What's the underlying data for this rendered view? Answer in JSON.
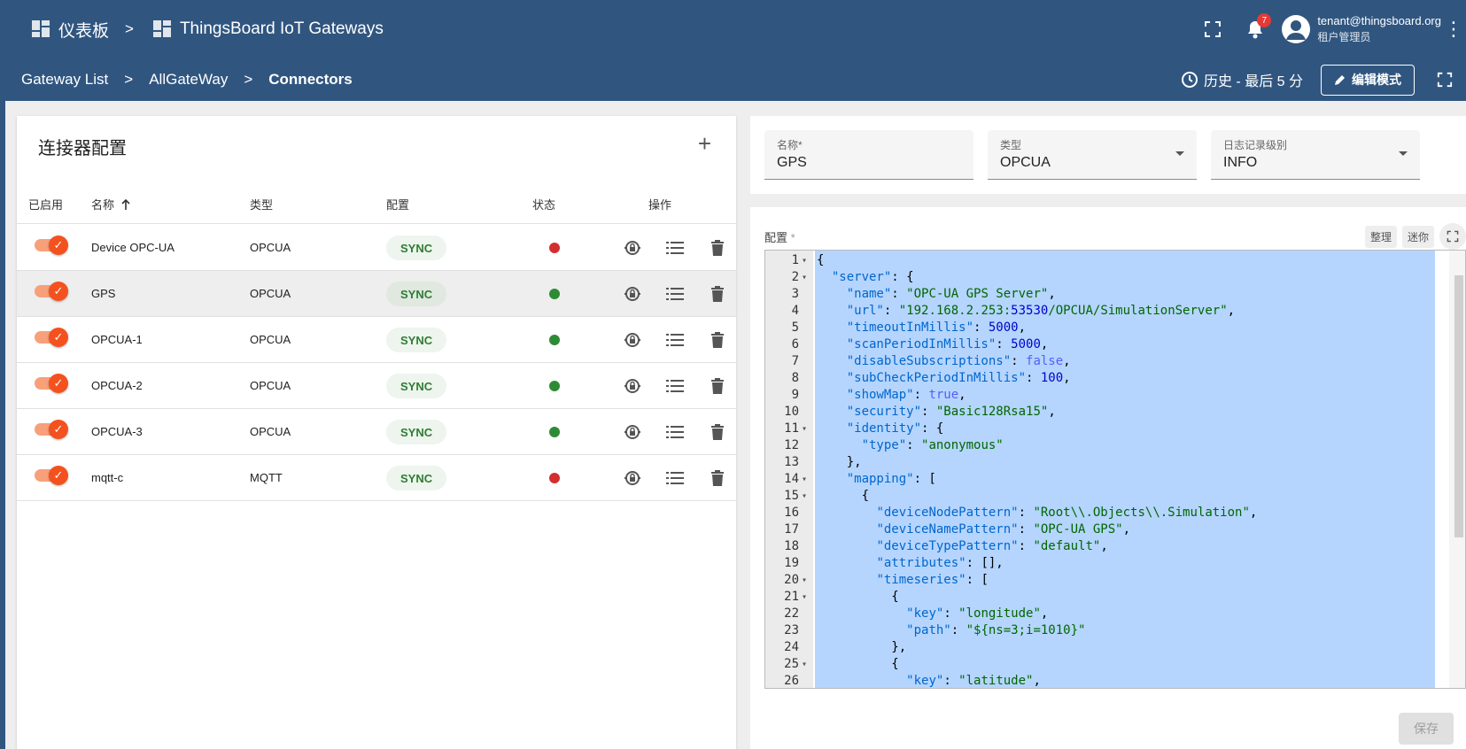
{
  "topbar": {
    "dashboards": "仪表板",
    "separator": ">",
    "dashboard_title": "ThingsBoard IoT Gateways",
    "notifications_count": "7",
    "user_email": "tenant@thingsboard.org",
    "user_role": "租户管理员"
  },
  "subbar": {
    "crumbs": [
      "Gateway List",
      "AllGateWay",
      "Connectors"
    ],
    "separator": ">",
    "history": "历史 - 最后 5 分",
    "edit_mode": "编辑模式"
  },
  "left_card": {
    "title": "连接器配置",
    "add": "+",
    "columns": {
      "enabled": "已启用",
      "name": "名称",
      "type": "类型",
      "config": "配置",
      "status": "状态",
      "actions": "操作"
    },
    "rows": [
      {
        "name": "Device OPC-UA",
        "type": "OPCUA",
        "config": "SYNC",
        "status_color": "#d32f2f",
        "enabled": true
      },
      {
        "name": "GPS",
        "type": "OPCUA",
        "config": "SYNC",
        "status_color": "#2e8b35",
        "enabled": true
      },
      {
        "name": "OPCUA-1",
        "type": "OPCUA",
        "config": "SYNC",
        "status_color": "#2e8b35",
        "enabled": true
      },
      {
        "name": "OPCUA-2",
        "type": "OPCUA",
        "config": "SYNC",
        "status_color": "#2e8b35",
        "enabled": true
      },
      {
        "name": "OPCUA-3",
        "type": "OPCUA",
        "config": "SYNC",
        "status_color": "#2e8b35",
        "enabled": true
      },
      {
        "name": "mqtt-c",
        "type": "MQTT",
        "config": "SYNC",
        "status_color": "#d32f2f",
        "enabled": true
      }
    ]
  },
  "right_top": {
    "name_label": "名称*",
    "name_value": "GPS",
    "type_label": "类型",
    "type_value": "OPCUA",
    "log_label": "日志记录级别",
    "log_value": "INFO"
  },
  "right_bottom": {
    "config_label": "配置",
    "required_mark": "*",
    "format": "整理",
    "minify": "迷你",
    "save": "保存"
  },
  "code_lines": [
    {
      "n": "1",
      "f": "▾",
      "t": "{"
    },
    {
      "n": "2",
      "f": "▾",
      "t": "  \"server\": {"
    },
    {
      "n": "3",
      "f": "",
      "t": "    \"name\": \"OPC-UA GPS Server\","
    },
    {
      "n": "4",
      "f": "",
      "t": "    \"url\": \"192.168.2.253:53530/OPCUA/SimulationServer\","
    },
    {
      "n": "5",
      "f": "",
      "t": "    \"timeoutInMillis\": 5000,"
    },
    {
      "n": "6",
      "f": "",
      "t": "    \"scanPeriodInMillis\": 5000,"
    },
    {
      "n": "7",
      "f": "",
      "t": "    \"disableSubscriptions\": false,"
    },
    {
      "n": "8",
      "f": "",
      "t": "    \"subCheckPeriodInMillis\": 100,"
    },
    {
      "n": "9",
      "f": "",
      "t": "    \"showMap\": true,"
    },
    {
      "n": "10",
      "f": "",
      "t": "    \"security\": \"Basic128Rsa15\","
    },
    {
      "n": "11",
      "f": "▾",
      "t": "    \"identity\": {"
    },
    {
      "n": "12",
      "f": "",
      "t": "      \"type\": \"anonymous\""
    },
    {
      "n": "13",
      "f": "",
      "t": "    },"
    },
    {
      "n": "14",
      "f": "▾",
      "t": "    \"mapping\": ["
    },
    {
      "n": "15",
      "f": "▾",
      "t": "      {"
    },
    {
      "n": "16",
      "f": "",
      "t": "        \"deviceNodePattern\": \"Root\\\\.Objects\\\\.Simulation\","
    },
    {
      "n": "17",
      "f": "",
      "t": "        \"deviceNamePattern\": \"OPC-UA GPS\","
    },
    {
      "n": "18",
      "f": "",
      "t": "        \"deviceTypePattern\": \"default\","
    },
    {
      "n": "19",
      "f": "",
      "t": "        \"attributes\": [],"
    },
    {
      "n": "20",
      "f": "▾",
      "t": "        \"timeseries\": ["
    },
    {
      "n": "21",
      "f": "▾",
      "t": "          {"
    },
    {
      "n": "22",
      "f": "",
      "t": "            \"key\": \"longitude\","
    },
    {
      "n": "23",
      "f": "",
      "t": "            \"path\": \"${ns=3;i=1010}\""
    },
    {
      "n": "24",
      "f": "",
      "t": "          },"
    },
    {
      "n": "25",
      "f": "▾",
      "t": "          {"
    },
    {
      "n": "26",
      "f": "",
      "t": "            \"key\": \"latitude\","
    }
  ],
  "colors": {
    "header": "#305680",
    "accent": "#f4511e",
    "chip_text": "#2e7d32",
    "selection": "#b5d5ff"
  }
}
